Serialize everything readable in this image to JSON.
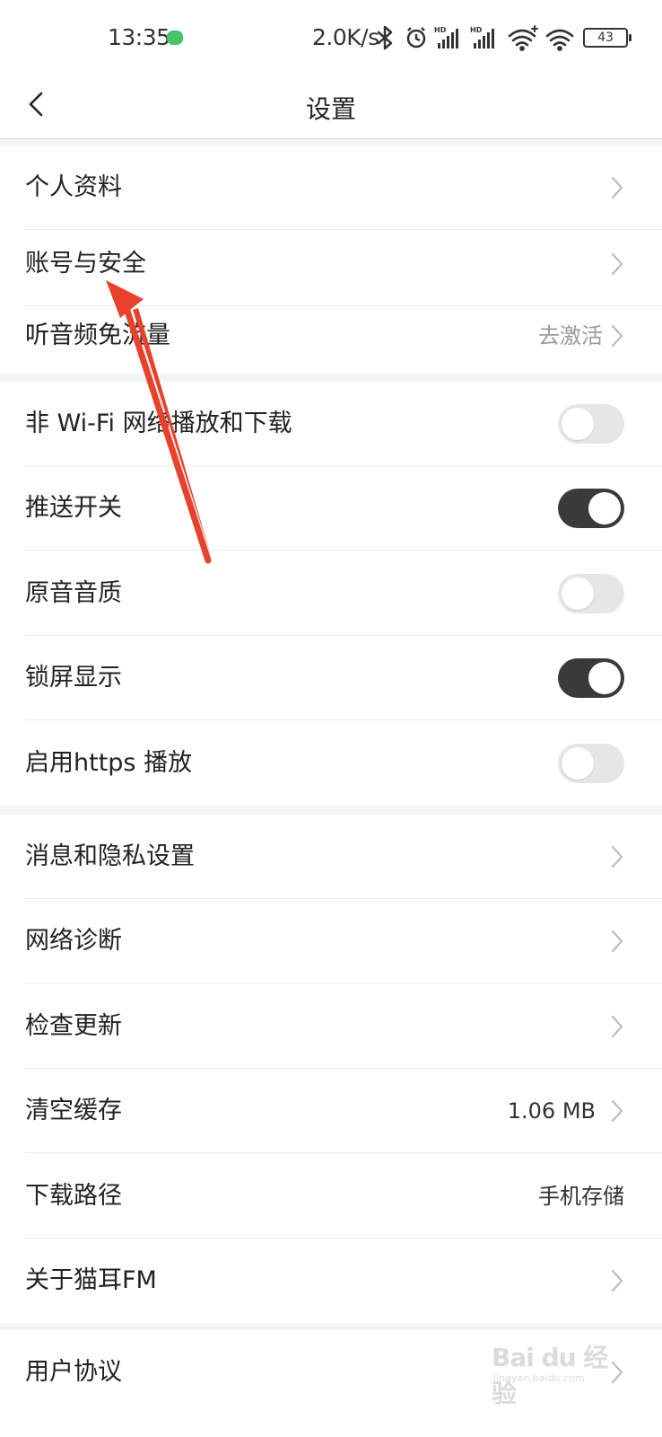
{
  "status_bar": {
    "time": "13:35",
    "net_speed": "2.0K/s",
    "battery": "43",
    "icons": [
      "bluetooth-icon",
      "alarm-icon",
      "hd-signal-icon",
      "hd-signal-icon",
      "wifi-plus-icon",
      "wifi-icon",
      "battery-icon"
    ]
  },
  "header": {
    "title": "设置",
    "back_icon": "chevron-left-icon"
  },
  "settings": {
    "personal_profile": "个人资料",
    "account_security": "账号与安全",
    "audio_free_data": "听音频免流量",
    "audio_free_data_value": "去激活",
    "non_wifi_play": "非 Wi-Fi 网络播放和下载",
    "non_wifi_play_on": false,
    "push_switch": "推送开关",
    "push_switch_on": true,
    "original_quality": "原音音质",
    "original_quality_on": false,
    "lock_screen": "锁屏显示",
    "lock_screen_on": true,
    "https_play": "启用https 播放",
    "https_play_on": false,
    "messages_privacy": "消息和隐私设置",
    "network_diagnosis": "网络诊断",
    "check_update": "检查更新",
    "clear_cache": "清空缓存",
    "clear_cache_value": "1.06 MB",
    "download_path": "下载路径",
    "download_path_value": "手机存储",
    "about": "关于猫耳FM",
    "user_agreement": "用户协议"
  },
  "colors": {
    "toggle_on": "#3a3a3a",
    "toggle_off": "#e6e6e6",
    "annotation_arrow": "#e8412c",
    "secondary_text": "#999999"
  },
  "watermark": {
    "brand": "Bai du 经验",
    "url": "jingyan.baidu.com"
  }
}
